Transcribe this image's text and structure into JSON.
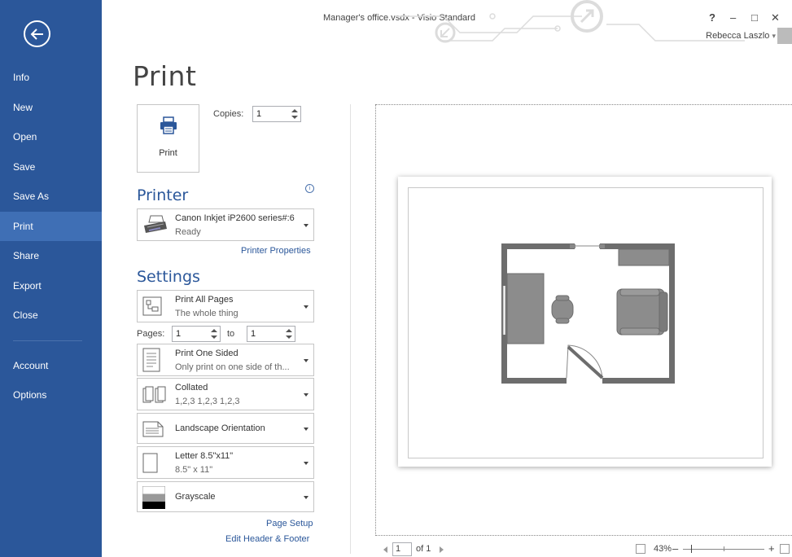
{
  "window": {
    "title": "Manager's office.vsdx - Visio Standard",
    "help": "?",
    "minimize": "–",
    "maximize": "□",
    "close": "✕",
    "user": "Rebecca Laszlo",
    "user_caret": "▾"
  },
  "sidebar": {
    "back_icon": "back-arrow-icon",
    "items": [
      {
        "label": "Info"
      },
      {
        "label": "New"
      },
      {
        "label": "Open"
      },
      {
        "label": "Save"
      },
      {
        "label": "Save As"
      },
      {
        "label": "Print",
        "active": true
      },
      {
        "label": "Share"
      },
      {
        "label": "Export"
      },
      {
        "label": "Close"
      },
      {
        "label": "Account"
      },
      {
        "label": "Options"
      }
    ],
    "bg_color": "#2b579a"
  },
  "print": {
    "heading": "Print",
    "button_label": "Print",
    "copies_label": "Copies:",
    "copies_value": "1"
  },
  "printer": {
    "section_title": "Printer",
    "name": "Canon Inkjet iP2600 series#:6",
    "status": "Ready",
    "properties_link": "Printer Properties"
  },
  "settings": {
    "section_title": "Settings",
    "range": {
      "title": "Print All Pages",
      "desc": "The whole thing"
    },
    "pages_label": "Pages:",
    "pages_from": "1",
    "to_label": "to",
    "pages_to": "1",
    "sided": {
      "title": "Print One Sided",
      "desc": "Only print on one side of th..."
    },
    "collation": {
      "title": "Collated",
      "desc": "1,2,3   1,2,3   1,2,3"
    },
    "orientation": {
      "title": "Landscape Orientation"
    },
    "paper": {
      "title": "Letter 8.5\"x11\"",
      "desc": "8.5\" x 11\""
    },
    "color": {
      "title": "Grayscale"
    },
    "page_setup_link": "Page Setup",
    "header_footer_link": "Edit Header & Footer"
  },
  "preview": {
    "page_current": "1",
    "page_of": "of 1",
    "zoom": "43%",
    "zoom_minus": "–",
    "zoom_plus": "+"
  },
  "colors": {
    "accent": "#2b579a",
    "active_nav": "#3f6fb5",
    "wall": "#6d6d6d",
    "furniture": "#8c8c8c"
  }
}
